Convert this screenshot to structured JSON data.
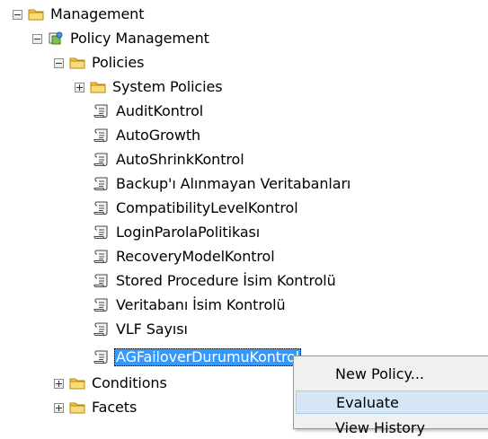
{
  "tree": {
    "management": {
      "label": "Management"
    },
    "policy_management": {
      "label": "Policy Management"
    },
    "policies": {
      "label": "Policies"
    },
    "system_policies": {
      "label": "System Policies"
    },
    "policy_items": [
      {
        "label": "AuditKontrol"
      },
      {
        "label": "AutoGrowth"
      },
      {
        "label": "AutoShrinkKontrol"
      },
      {
        "label": "Backup'ı Alınmayan Veritabanları"
      },
      {
        "label": "CompatibilityLevelKontrol"
      },
      {
        "label": "LoginParolaPolitikası"
      },
      {
        "label": "RecoveryModelKontrol"
      },
      {
        "label": "Stored Procedure İsim Kontrolü"
      },
      {
        "label": "Veritabanı İsim Kontrolü"
      },
      {
        "label": "VLF Sayısı"
      },
      {
        "label": "AGFailoverDurumuKontrol"
      }
    ],
    "conditions": {
      "label": "Conditions"
    },
    "facets": {
      "label": "Facets"
    }
  },
  "context_menu": {
    "items": [
      {
        "label": "New Policy..."
      },
      {
        "label": "Evaluate"
      },
      {
        "label": "View History"
      }
    ]
  },
  "colors": {
    "selection": "#3399ff",
    "menu_hover": "#d5e6f7",
    "folder": "#f2c94c"
  }
}
